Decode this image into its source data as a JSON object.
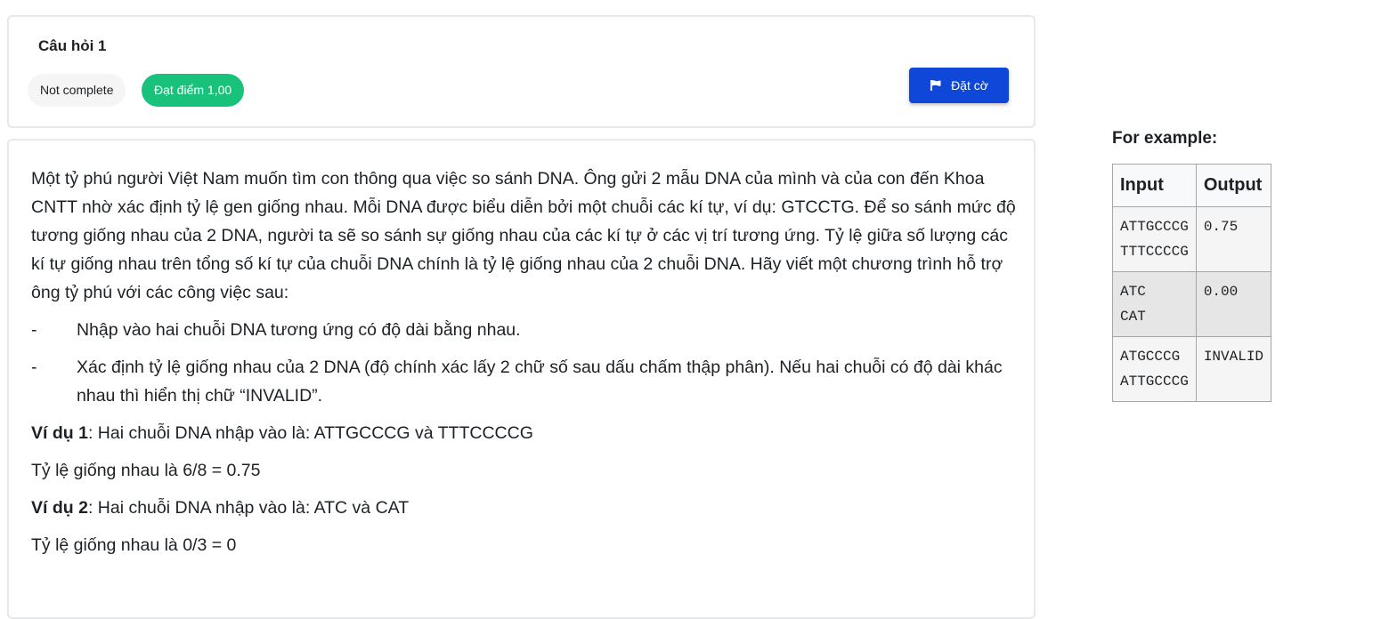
{
  "question": {
    "title": "Câu hỏi 1",
    "state": "Not complete",
    "grade": "Đạt điểm 1,00",
    "flag_label": "Đặt cờ",
    "flag_icon": "flag-icon"
  },
  "body": {
    "paragraph": "Một tỷ phú người Việt Nam muốn tìm con thông qua việc so sánh DNA. Ông gửi 2 mẫu DNA của mình và của con đến Khoa CNTT nhờ xác định tỷ lệ gen giống nhau. Mỗi DNA được biểu diễn bởi một chuỗi các kí tự, ví dụ: GTCCTG. Để so sánh mức độ tương giống nhau của 2 DNA, người ta sẽ so sánh sự giống nhau của các kí tự ở các vị trí tương ứng. Tỷ lệ giữa số lượng các kí tự giống nhau trên tổng số kí tự của chuỗi DNA chính là tỷ lệ giống nhau của 2 chuỗi DNA. Hãy viết một chương trình hỗ trợ ông tỷ phú với các công việc sau:",
    "bullets": [
      {
        "dash": "-",
        "text": "Nhập vào hai chuỗi DNA tương ứng có độ dài bằng nhau."
      },
      {
        "dash": "-",
        "text": "Xác định tỷ lệ giống nhau của 2 DNA (độ chính xác lấy 2 chữ số sau dấu chấm thập phân). Nếu hai chuỗi có độ dài khác nhau thì hiển thị chữ “INVALID”."
      }
    ],
    "example1_label": "Ví dụ 1",
    "example1_text": ": Hai chuỗi DNA nhập vào là: ATTGCCCG và TTTCCCCG",
    "example1_result": "Tỷ lệ giống nhau là 6/8 = 0.75",
    "example2_label": "Ví dụ 2",
    "example2_text": ": Hai chuỗi DNA nhập vào là:  ATC và CAT",
    "example2_result": "Tỷ lệ giống nhau là 0/3 = 0"
  },
  "examples": {
    "heading": "For example:",
    "columns": [
      "Input",
      "Output"
    ],
    "rows": [
      {
        "input": "ATTGCCCG\nTTTCCCCG",
        "output": "0.75"
      },
      {
        "input": "ATC\nCAT",
        "output": "0.00"
      },
      {
        "input": "ATGCCCG\nATTGCCCG",
        "output": "INVALID"
      }
    ]
  }
}
